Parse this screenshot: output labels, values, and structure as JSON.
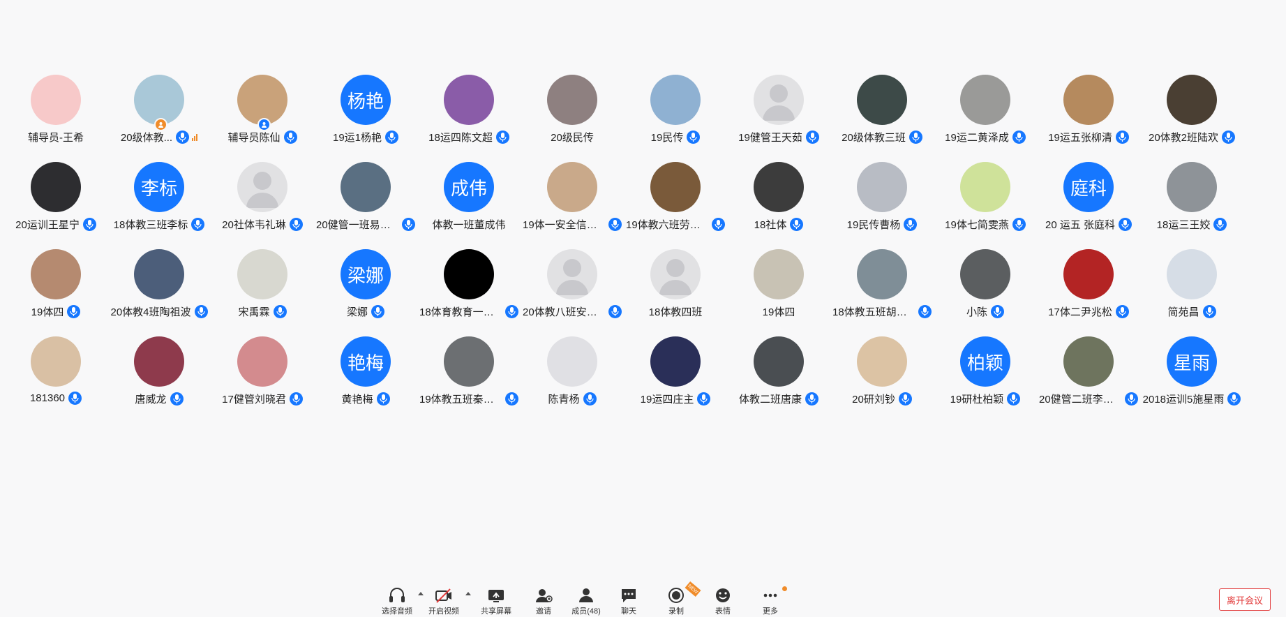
{
  "participants": [
    {
      "name": "辅导员-王希",
      "avatar": "image",
      "color": "#f7c9c9",
      "mic": false,
      "badge": ""
    },
    {
      "name": "20级体教...",
      "avatar": "image",
      "color": "#a9c8d8",
      "mic": true,
      "badge": "orange",
      "signal": true
    },
    {
      "name": "辅导员陈仙",
      "avatar": "image",
      "color": "#c9a27a",
      "mic": true,
      "badge": "blue"
    },
    {
      "name": "19运1杨艳",
      "avatar": "text",
      "initials": "杨艳",
      "mic": true
    },
    {
      "name": "18运四陈文超",
      "avatar": "image",
      "color": "#8a5ca8",
      "mic": true
    },
    {
      "name": "20级民传",
      "avatar": "image",
      "color": "#8e8080",
      "mic": false
    },
    {
      "name": "19民传",
      "avatar": "image",
      "color": "#8fb1d2",
      "mic": true
    },
    {
      "name": "19健管王天茹",
      "avatar": "person",
      "mic": true
    },
    {
      "name": "20级体教三班",
      "avatar": "image",
      "color": "#3d4a48",
      "mic": true
    },
    {
      "name": "19运二黄泽成",
      "avatar": "image",
      "color": "#9a9a98",
      "mic": true
    },
    {
      "name": "19运五张柳清",
      "avatar": "image",
      "color": "#b58a5e",
      "mic": true
    },
    {
      "name": "20体教2班陆欢",
      "avatar": "image",
      "color": "#4a3f33",
      "mic": true
    },
    {
      "name": "20运训王星宁",
      "avatar": "image",
      "color": "#2d2d30",
      "mic": true
    },
    {
      "name": "18体教三班李标",
      "avatar": "text",
      "initials": "李标",
      "mic": true
    },
    {
      "name": "20社体韦礼琳",
      "avatar": "person",
      "mic": true
    },
    {
      "name": "20健管一班易芬...",
      "avatar": "image",
      "color": "#5a6f82",
      "mic": true
    },
    {
      "name": "体教一班董成伟",
      "avatar": "text",
      "initials": "成伟",
      "mic": false
    },
    {
      "name": "19体一安全信息...",
      "avatar": "image",
      "color": "#c9a98a",
      "mic": true
    },
    {
      "name": "19体教六班劳惠...",
      "avatar": "image",
      "color": "#7a5a3a",
      "mic": true
    },
    {
      "name": "18社体",
      "avatar": "image",
      "color": "#3c3c3c",
      "mic": true
    },
    {
      "name": "19民传曹杨",
      "avatar": "image",
      "color": "#b8bcc4",
      "mic": true
    },
    {
      "name": "19体七简雯燕",
      "avatar": "image",
      "color": "#cfe29a",
      "mic": true
    },
    {
      "name": "20 运五 张庭科",
      "avatar": "text",
      "initials": "庭科",
      "mic": true
    },
    {
      "name": "18运三王姣",
      "avatar": "image",
      "color": "#8e9398",
      "mic": true
    },
    {
      "name": "19体四",
      "avatar": "image",
      "color": "#b58a70",
      "mic": true
    },
    {
      "name": "20体教4班陶祖波",
      "avatar": "image",
      "color": "#4c5e7a",
      "mic": true
    },
    {
      "name": "宋禹霖",
      "avatar": "image",
      "color": "#d8d8d0",
      "mic": true
    },
    {
      "name": "梁娜",
      "avatar": "text",
      "initials": "梁娜",
      "mic": true
    },
    {
      "name": "18体育教育一班...",
      "avatar": "image",
      "color": "#000000",
      "mic": true
    },
    {
      "name": "20体教八班安全...",
      "avatar": "person",
      "mic": true
    },
    {
      "name": "18体教四班",
      "avatar": "person",
      "mic": false
    },
    {
      "name": "19体四",
      "avatar": "image",
      "color": "#c8c2b4",
      "mic": false
    },
    {
      "name": "18体教五班胡颖...",
      "avatar": "image",
      "color": "#7f8e97",
      "mic": true
    },
    {
      "name": "小陈",
      "avatar": "image",
      "color": "#5b5e60",
      "mic": true
    },
    {
      "name": "17体二尹兆松",
      "avatar": "image",
      "color": "#b32424",
      "mic": true
    },
    {
      "name": "简苑昌",
      "avatar": "image",
      "color": "#d6dde6",
      "mic": true
    },
    {
      "name": "181360",
      "avatar": "image",
      "color": "#d9c0a4",
      "mic": true
    },
    {
      "name": "唐威龙",
      "avatar": "image",
      "color": "#8e3a4c",
      "mic": true
    },
    {
      "name": "17健管刘晓君",
      "avatar": "image",
      "color": "#d38b8e",
      "mic": true
    },
    {
      "name": "黄艳梅",
      "avatar": "text",
      "initials": "艳梅",
      "mic": true
    },
    {
      "name": "19体教五班秦海...",
      "avatar": "image",
      "color": "#6c6f72",
      "mic": true
    },
    {
      "name": "陈青杨",
      "avatar": "image",
      "color": "#e0e0e4",
      "mic": true
    },
    {
      "name": "19运四庄主",
      "avatar": "image",
      "color": "#2a2f58",
      "mic": true
    },
    {
      "name": "体教二班唐康",
      "avatar": "image",
      "color": "#4a4e52",
      "mic": true
    },
    {
      "name": "20研刘钞",
      "avatar": "image",
      "color": "#dcc3a4",
      "mic": true
    },
    {
      "name": "19研杜柏颖",
      "avatar": "text",
      "initials": "柏颖",
      "mic": true
    },
    {
      "name": "20健管二班李亚...",
      "avatar": "image",
      "color": "#6e745e",
      "mic": true
    },
    {
      "name": "2018运训5施星雨",
      "avatar": "text",
      "initials": "星雨",
      "mic": true
    }
  ],
  "toolbar": {
    "audio_label": "选择音频",
    "video_label": "开启视频",
    "share_label": "共享屏幕",
    "invite_label": "邀请",
    "members_label": "成员(48)",
    "chat_label": "聊天",
    "record_label": "录制",
    "emoji_label": "表情",
    "more_label": "更多",
    "leave_label": "离开会议",
    "record_badge": "NEW"
  },
  "colors": {
    "accent": "#1677ff",
    "leave": "#e23a3a",
    "badge": "#f08c2a",
    "background": "#f8f8f9"
  }
}
